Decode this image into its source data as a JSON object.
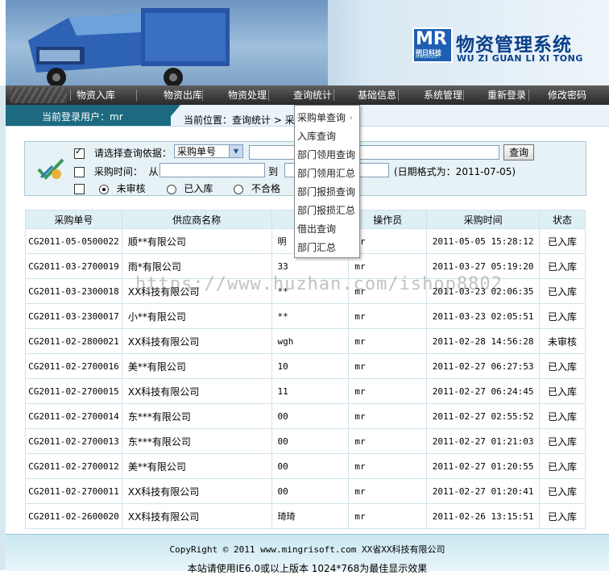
{
  "header": {
    "logo_mark": "MR",
    "logo_brand": "明日科技",
    "logo_brand_en": "MINGRISOFT",
    "title": "物资管理系统",
    "subtitle": "WU ZI GUAN LI XI TONG"
  },
  "nav": {
    "items": [
      {
        "label": "物资入库"
      },
      {
        "label": "物资出库"
      },
      {
        "label": "物资处理"
      },
      {
        "label": "查询统计"
      },
      {
        "label": "基础信息"
      },
      {
        "label": "系统管理"
      },
      {
        "label": "重新登录"
      },
      {
        "label": "修改密码"
      }
    ]
  },
  "userbar": {
    "current_user": "当前登录用户：mr",
    "location": "当前位置：查询统计 > 采"
  },
  "dropdown": {
    "items": [
      {
        "label": "采购单查询"
      },
      {
        "label": "入库查询"
      },
      {
        "label": "部门领用查询"
      },
      {
        "label": "部门领用汇总"
      },
      {
        "label": "部门报损查询"
      },
      {
        "label": "部门报损汇总"
      },
      {
        "label": "借出查询"
      },
      {
        "label": "部门汇总"
      }
    ]
  },
  "search": {
    "basis_label": "请选择查询依据：",
    "basis_selected": "采购单号",
    "query_button": "查询",
    "time_label": "采购时间：",
    "from_label": "从",
    "to_label": "到",
    "date_format": "(日期格式为：2011-07-05)",
    "status_options": [
      {
        "label": "未审核",
        "checked": true
      },
      {
        "label": "已入库",
        "checked": false
      },
      {
        "label": "不合格",
        "checked": false
      }
    ]
  },
  "table": {
    "columns": [
      "采购单号",
      "供应商名称",
      "",
      "操作员",
      "采购时间",
      "状态"
    ],
    "rows": [
      [
        "CG2011-05-0500022",
        "顺**有限公司",
        "明",
        "mr",
        "2011-05-05 15:28:12",
        "已入库"
      ],
      [
        "CG2011-03-2700019",
        "雨*有限公司",
        "33",
        "mr",
        "2011-03-27 05:19:20",
        "已入库"
      ],
      [
        "CG2011-03-2300018",
        "XX科技有限公司",
        "**",
        "mr",
        "2011-03-23 02:06:35",
        "已入库"
      ],
      [
        "CG2011-03-2300017",
        "小**有限公司",
        "**",
        "mr",
        "2011-03-23 02:05:51",
        "已入库"
      ],
      [
        "CG2011-02-2800021",
        "XX科技有限公司",
        "wgh",
        "mr",
        "2011-02-28 14:56:28",
        "未审核"
      ],
      [
        "CG2011-02-2700016",
        "美**有限公司",
        "10",
        "mr",
        "2011-02-27 06:27:53",
        "已入库"
      ],
      [
        "CG2011-02-2700015",
        "XX科技有限公司",
        "11",
        "mr",
        "2011-02-27 06:24:45",
        "已入库"
      ],
      [
        "CG2011-02-2700014",
        "东***有限公司",
        "00",
        "mr",
        "2011-02-27 02:55:52",
        "已入库"
      ],
      [
        "CG2011-02-2700013",
        "东***有限公司",
        "00",
        "mr",
        "2011-02-27 01:21:03",
        "已入库"
      ],
      [
        "CG2011-02-2700012",
        "美**有限公司",
        "00",
        "mr",
        "2011-02-27 01:20:55",
        "已入库"
      ],
      [
        "CG2011-02-2700011",
        "XX科技有限公司",
        "00",
        "mr",
        "2011-02-27 01:20:41",
        "已入库"
      ],
      [
        "CG2011-02-2600020",
        "XX科技有限公司",
        "琦琦",
        "mr",
        "2011-02-26 13:15:51",
        "已入库"
      ]
    ]
  },
  "watermark": "https://www.huzhan.com/ishop8802",
  "footer": {
    "copyright": "CopyRight © 2011 www.mingrisoft.com XX省XX科技有限公司",
    "note": "本站请使用IE6.0或以上版本 1024*768为最佳显示效果"
  },
  "colors": {
    "nav_bg": "#3f3f3f",
    "userbar_accent": "#1c6a80",
    "panel_bg": "#e7f2f6",
    "title_blue": "#0a3f8a"
  }
}
